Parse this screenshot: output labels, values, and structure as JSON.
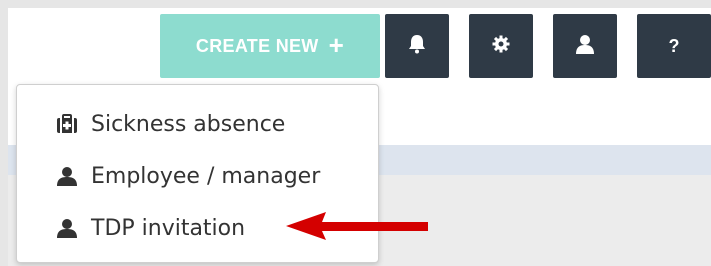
{
  "toolbar": {
    "create_label": "CREATE NEW",
    "create_icon": "plus-icon",
    "buttons": [
      {
        "icon": "bell-icon"
      },
      {
        "icon": "gear-icon"
      },
      {
        "icon": "user-icon"
      },
      {
        "icon": "help-icon",
        "glyph": "?"
      }
    ]
  },
  "menu": {
    "items": [
      {
        "label": "Sickness absence",
        "icon": "medical-kit-icon"
      },
      {
        "label": "Employee / manager",
        "icon": "user-icon"
      },
      {
        "label": "TDP invitation",
        "icon": "user-icon"
      }
    ]
  },
  "colors": {
    "create_button": "#8ddccf",
    "icon_button": "#2f3a46",
    "annotation_arrow": "#d40000",
    "band": "#dde4ee"
  }
}
